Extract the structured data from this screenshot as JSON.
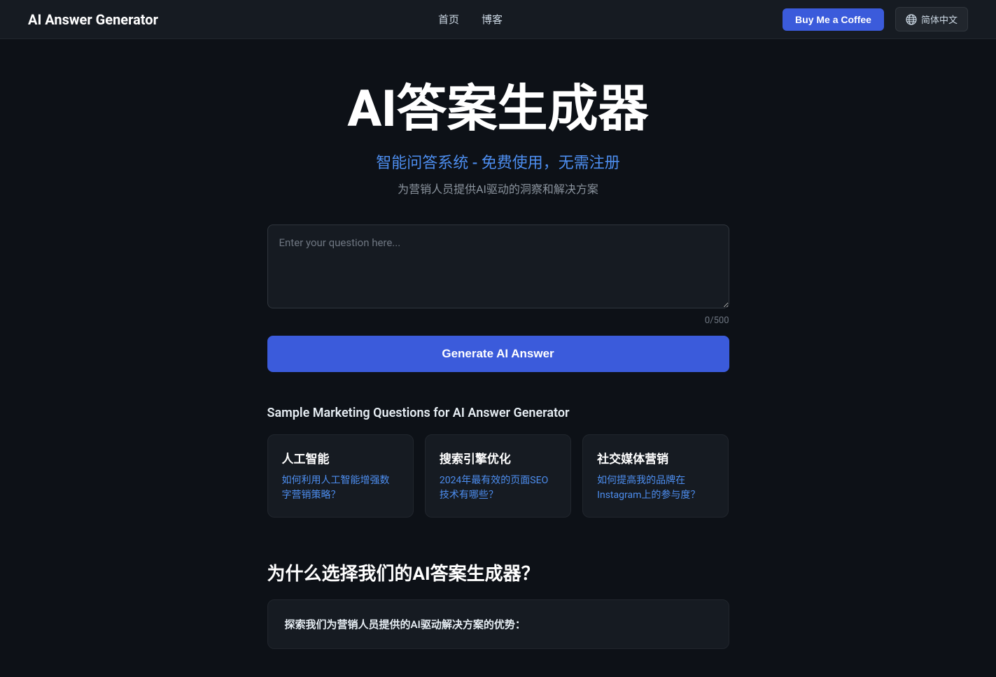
{
  "nav": {
    "logo": "AI Answer Generator",
    "links": [
      {
        "label": "首页",
        "id": "home"
      },
      {
        "label": "博客",
        "id": "blog"
      }
    ],
    "buy_coffee_label": "Buy Me a Coffee",
    "lang_label": "简体中文"
  },
  "hero": {
    "title": "AI答案生成器",
    "subtitle": "智能问答系统 - 免费使用，无需注册",
    "description": "为营销人员提供AI驱动的洞察和解决方案"
  },
  "input": {
    "placeholder": "Enter your question here...",
    "char_count": "0/500"
  },
  "generate_button": {
    "label": "Generate AI Answer"
  },
  "sample_section": {
    "title": "Sample Marketing Questions for AI Answer Generator",
    "cards": [
      {
        "category": "人工智能",
        "question": "如何利用人工智能增强数字营销策略？"
      },
      {
        "category": "搜索引擎优化",
        "question": "2024年最有效的页面SEO技术有哪些？"
      },
      {
        "category": "社交媒体营销",
        "question": "如何提高我的品牌在Instagram上的参与度？"
      }
    ]
  },
  "why_section": {
    "title": "为什么选择我们的AI答案生成器？",
    "box_text": "探索我们为营销人员提供的AI驱动解决方案的优势："
  }
}
